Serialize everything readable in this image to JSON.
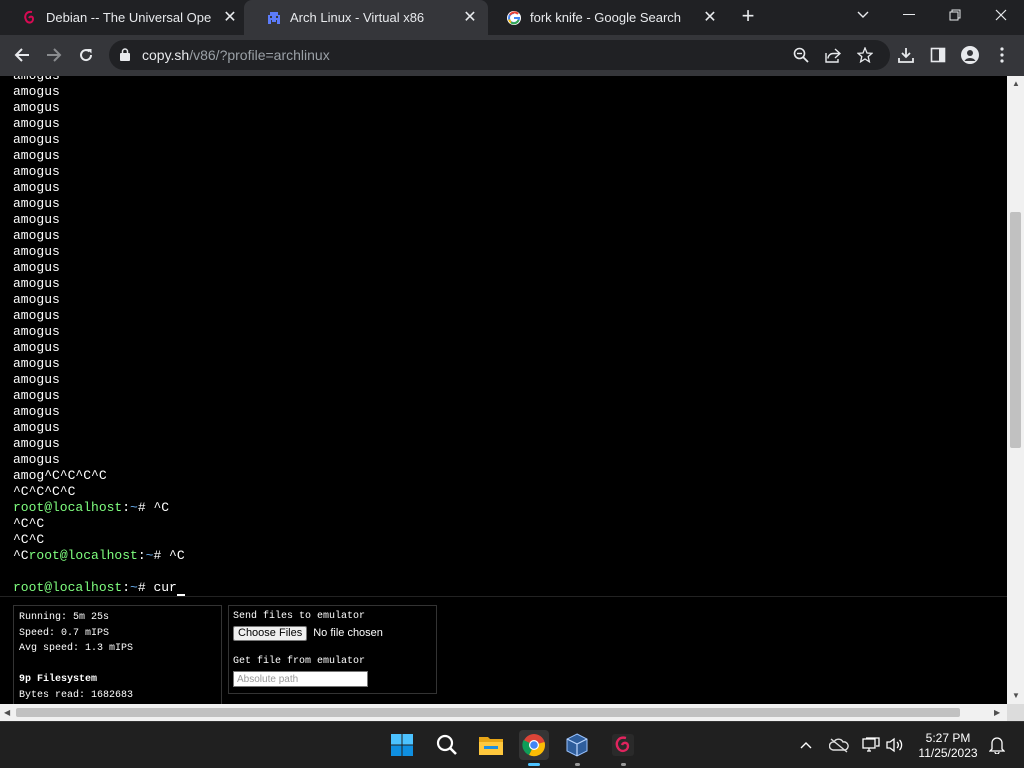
{
  "tabs": [
    {
      "title": "Debian -- The Universal Operating System",
      "icon": "debian-swirl-icon",
      "active": false
    },
    {
      "title": "Arch Linux - Virtual x86",
      "icon": "pixel-invader-icon",
      "active": true
    },
    {
      "title": "fork knife - Google Search",
      "icon": "google-g-icon",
      "active": false
    }
  ],
  "toolbar": {
    "url_host": "copy.sh",
    "url_path": "/v86/?profile=archlinux"
  },
  "terminal": {
    "repeat_word": "amogus",
    "repeat_count": 25,
    "tail_lines": [
      {
        "type": "plain",
        "text": "amog^C^C^C^C"
      },
      {
        "type": "plain",
        "text": "^C^C^C^C"
      },
      {
        "type": "prompt",
        "pre": "",
        "user": "root@localhost",
        "sep": ":",
        "dir": "~",
        "cmd": "# ^C"
      },
      {
        "type": "plain",
        "text": "^C^C"
      },
      {
        "type": "plain",
        "text": "^C^C"
      },
      {
        "type": "prompt",
        "pre": "^C",
        "user": "root@localhost",
        "sep": ":",
        "dir": "~",
        "cmd": "# ^C"
      },
      {
        "type": "plain",
        "text": ""
      },
      {
        "type": "prompt",
        "pre": "",
        "user": "root@localhost",
        "sep": ":",
        "dir": "~",
        "cmd": "# cur",
        "cursor": true
      }
    ]
  },
  "stats": {
    "running": "Running: 5m 25s",
    "speed": "Speed: 0.7 mIPS",
    "avg_speed": "Avg speed: 1.3 mIPS",
    "fs_title": "9p Filesystem",
    "bytes_read": "Bytes read: 1682683"
  },
  "files": {
    "send_label": "Send files to emulator",
    "choose_button": "Choose Files",
    "choose_status": "No file chosen",
    "get_label": "Get file from emulator",
    "path_placeholder": "Absolute path"
  },
  "taskbar": {
    "apps": [
      "windows-start-icon",
      "search-icon",
      "file-explorer-icon",
      "chrome-icon",
      "virtualbox-icon",
      "debian-app-icon"
    ],
    "time": "5:27 PM",
    "date": "11/25/2023"
  }
}
